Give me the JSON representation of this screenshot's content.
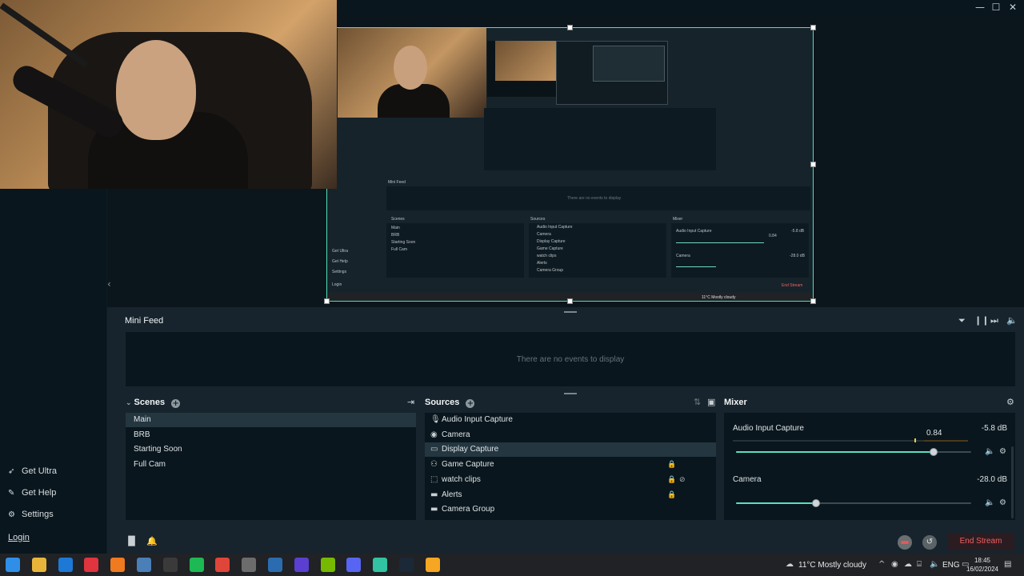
{
  "window": {
    "minimize_glyph": "—",
    "maximize_glyph": "☐",
    "close_glyph": "✕"
  },
  "nav": {
    "items": [
      {
        "label": "Get Ultra",
        "icon": "rocket-icon"
      },
      {
        "label": "Get Help",
        "icon": "help-icon"
      },
      {
        "label": "Settings",
        "icon": "gear-icon"
      }
    ],
    "login": "Login"
  },
  "editor": {
    "nested": {
      "mini_feed": "Mini Feed",
      "no_events": "There are no events to display",
      "scenes": "Scenes",
      "sources": "Sources",
      "mixer": "Mixer",
      "scene_items": [
        "Main",
        "BRB",
        "Starting Soon",
        "Full Cam"
      ],
      "source_items": [
        "Audio Input Capture",
        "Camera",
        "Display Capture",
        "Game Capture",
        "watch clips",
        "Alerts",
        "Camera Group"
      ],
      "nav_items": [
        "Get Ultra",
        "Get Help",
        "Settings"
      ],
      "login": "Login",
      "mix_audio": "Audio Input Capture",
      "mix_audio_db": "-5.8 dB",
      "mix_audio_val": "0.84",
      "mix_camera": "Camera",
      "mix_camera_db": "-28.0 dB",
      "end_stream": "End Stream",
      "weather": "11°C Mostly cloudy"
    }
  },
  "mini_feed": {
    "title": "Mini Feed",
    "empty_text": "There are no events to display"
  },
  "scenes": {
    "title": "Scenes",
    "items": [
      "Main",
      "BRB",
      "Starting Soon",
      "Full Cam"
    ],
    "selected_index": 0
  },
  "sources": {
    "title": "Sources",
    "items": [
      {
        "label": "Audio Input Capture",
        "icon": "microphone-icon",
        "locked": false,
        "hidden": false
      },
      {
        "label": "Camera",
        "icon": "camera-icon",
        "locked": false,
        "hidden": false
      },
      {
        "label": "Display Capture",
        "icon": "monitor-icon",
        "locked": false,
        "hidden": false
      },
      {
        "label": "Game Capture",
        "icon": "gamepad-icon",
        "locked": true,
        "hidden": false
      },
      {
        "label": "watch clips",
        "icon": "browser-source-icon",
        "locked": true,
        "hidden": true
      },
      {
        "label": "Alerts",
        "icon": "folder-icon",
        "locked": true,
        "hidden": false
      },
      {
        "label": "Camera Group",
        "icon": "folder-icon",
        "locked": false,
        "hidden": false
      }
    ],
    "selected_index": 2
  },
  "mixer": {
    "title": "Mixer",
    "channels": [
      {
        "name": "Audio Input Capture",
        "db": "-5.8 dB",
        "value_label": "0.84",
        "level": 0.84
      },
      {
        "name": "Camera",
        "db": "-28.0 dB",
        "level": 0.34
      }
    ]
  },
  "footer": {
    "end_stream": "End Stream"
  },
  "taskbar": {
    "weather": "11°C  Mostly cloudy",
    "lang": "ENG",
    "time": "18:45",
    "date": "16/02/2024",
    "apps": [
      {
        "name": "windows-start-icon",
        "color": "#2f8fe8"
      },
      {
        "name": "file-explorer-icon",
        "color": "#e8b53a"
      },
      {
        "name": "mail-icon",
        "color": "#1e78d6"
      },
      {
        "name": "opera-icon",
        "color": "#e0343e"
      },
      {
        "name": "firefox-icon",
        "color": "#ef7a1f"
      },
      {
        "name": "photos-icon",
        "color": "#4a7fb8"
      },
      {
        "name": "terminal-icon",
        "color": "#3a3a3a"
      },
      {
        "name": "spotify-icon",
        "color": "#1db954"
      },
      {
        "name": "chrome-icon",
        "color": "#e0453a"
      },
      {
        "name": "settings-icon",
        "color": "#6c6c6c"
      },
      {
        "name": "paint-icon",
        "color": "#2b6cb0"
      },
      {
        "name": "visual-studio-icon",
        "color": "#5a3fd1"
      },
      {
        "name": "nvidia-icon",
        "color": "#76b900"
      },
      {
        "name": "discord-icon",
        "color": "#5865f2"
      },
      {
        "name": "streamlabs-icon",
        "color": "#31c3a2"
      },
      {
        "name": "steam-icon",
        "color": "#1b2838"
      },
      {
        "name": "sublime-icon",
        "color": "#f5a623"
      }
    ]
  }
}
